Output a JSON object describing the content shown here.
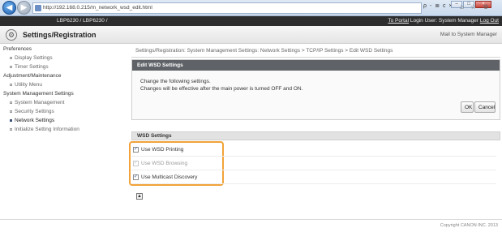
{
  "browser": {
    "address": "http://192.168.0.215/m_network_wsd_edit.html",
    "address_tools": "ρ - ≣ c ×",
    "icons": "⌂ ☆ ⚙",
    "minimize": "–",
    "maximize": "□",
    "close": "×"
  },
  "header": {
    "device_name": "LBP6230 / LBP6230 /",
    "top_portal": "To Portal",
    "login_user": "Login User: System Manager",
    "logout": "Log Out"
  },
  "title_bar": {
    "title": "Settings/Registration",
    "mail_link": "Mail to System Manager"
  },
  "sidebar": {
    "preferences": "Preferences",
    "display_settings": "Display Settings",
    "timer_settings": "Timer Settings",
    "adjustment_maintenance": "Adjustment/Maintenance",
    "utility_menu": "Utility Menu",
    "system_management_settings": "System Management Settings",
    "system_management": "System Management",
    "security_settings": "Security Settings",
    "network_settings": "Network Settings",
    "initialize_setting_information": "Initialize Setting Information"
  },
  "main": {
    "breadcrumb": "Settings/Registration: System Management Settings: Network Settings > TCP/IP Settings > Edit WSD Settings",
    "panel_title": "Edit WSD Settings",
    "message_line1": "Change the following settings.",
    "message_line2": "Changes will be effective after the main power is turned OFF and ON.",
    "ok_label": "OK",
    "cancel_label": "Cancel",
    "wsd_section_title": "WSD Settings",
    "options": [
      {
        "label": "Use WSD Printing",
        "checked": true,
        "enabled": true
      },
      {
        "label": "Use WSD Browsing",
        "checked": true,
        "enabled": false
      },
      {
        "label": "Use Multicast Discovery",
        "checked": true,
        "enabled": true
      }
    ],
    "check_mark": "✓",
    "top_link_glyph": "▲"
  },
  "footer": {
    "copyright": "Copyright CANON INC. 2013"
  },
  "colors": {
    "header_bg": "#2d2d2d",
    "panel_head_bg": "#5f6368",
    "highlight": "#f2a33a"
  }
}
